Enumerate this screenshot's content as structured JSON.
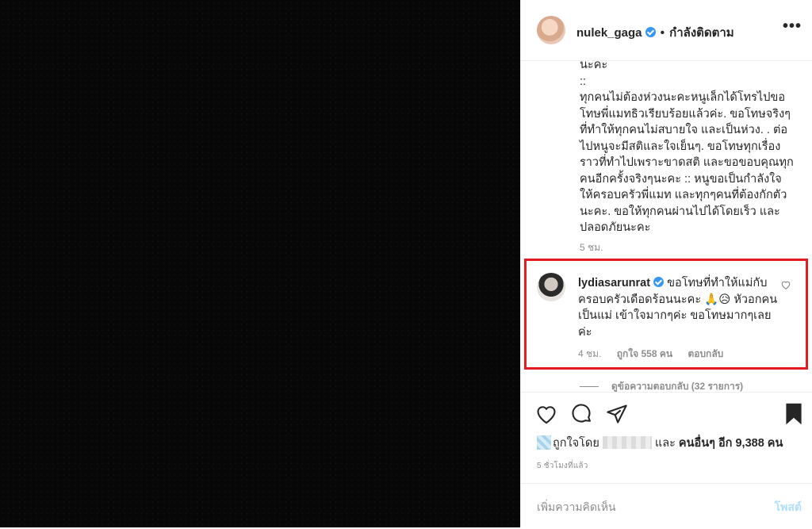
{
  "header": {
    "username": "nulek_gaga",
    "separator": "•",
    "follow_status": "กำลังติดตาม",
    "more_label": "•••"
  },
  "caption": {
    "text": "นะคะ\n::\nทุกคนไม่ต้องห่วงนะคะหนูเล็กได้โทรไปขอโทษพี่แมทธิวเรียบร้อยแล้วค่ะ. ขอโทษจริงๆที่ทำให้ทุกคนไม่สบายใจ และเป็นห่วง. . ต่อไปหนูจะมีสติและใจเย็นๆ. ขอโทษทุกเรื่องราวที่ทำไปเพราะขาดสติ และขอขอบคุณทุกคนอีกครั้งจริงๆนะคะ :: หนูขอเป็นกำลังใจให้ครอบครัวพี่แมท และทุกๆคนที่ต้องกักตัวนะคะ. ขอให้ทุกคนผ่านไปได้โดยเร็ว และปลอดภัยนะคะ",
    "time": "5 ชม."
  },
  "comment": {
    "username": "lydiasarunrat",
    "text": "ขอโทษที่ทำให้แม่กับครอบครัวเดือดร้อนนะคะ 🙏😥 หัวอกคนเป็นแม่ เข้าใจมากๆค่ะ ขอโทษมากๆเลยค่ะ",
    "time": "4 ชม.",
    "likes": "ถูกใจ 558 คน",
    "reply": "ตอบกลับ"
  },
  "replies": {
    "label": "ดูข้อความตอบกลับ (32 รายการ)"
  },
  "likes": {
    "prefix": "ถูกใจโดย",
    "and": "และ",
    "others": "คนอื่นๆ อีก 9,388 คน"
  },
  "timestamp": "5 ชั่วโมงที่แล้ว",
  "add_comment": {
    "placeholder": "เพิ่มความคิดเห็น",
    "post_label": "โพสต์"
  },
  "colors": {
    "verified": "#3897f0",
    "highlight_border": "#e31b23",
    "post_disabled": "#b2dffc"
  }
}
